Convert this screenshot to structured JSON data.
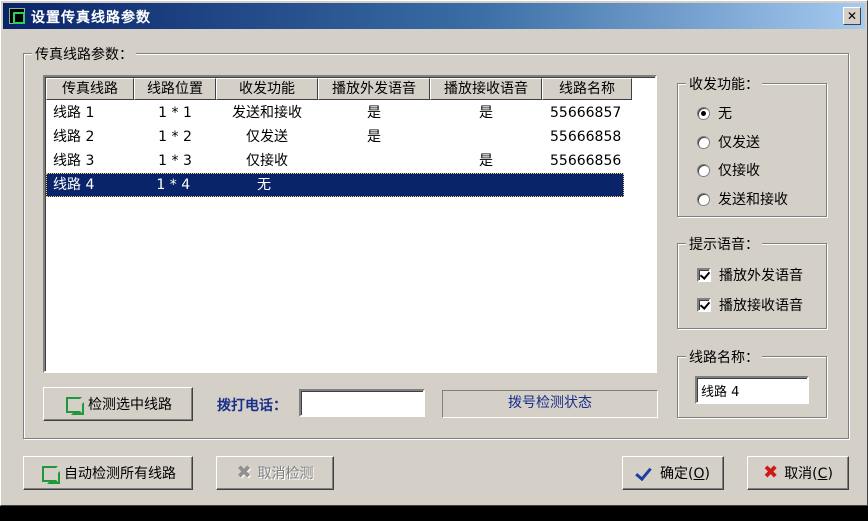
{
  "window": {
    "title": "设置传真线路参数",
    "close_glyph": "✕"
  },
  "fax_params_group": {
    "label": "传真线路参数："
  },
  "table": {
    "columns": [
      "传真线路",
      "线路位置",
      "收发功能",
      "播放外发语音",
      "播放接收语音",
      "线路名称"
    ],
    "rows": [
      [
        "线路 1",
        "1 * 1",
        "发送和接收",
        "是",
        "是",
        "55666857"
      ],
      [
        "线路 2",
        "1 * 2",
        "仅发送",
        "是",
        "",
        "55666858"
      ],
      [
        "线路 3",
        "1 * 3",
        "仅接收",
        "",
        "是",
        "55666856"
      ],
      [
        "线路 4",
        "1 * 4",
        "无",
        "",
        "",
        ""
      ]
    ],
    "selected_row": 3
  },
  "detect_selected_button": {
    "label": "检测选中线路",
    "icon": "network-icon"
  },
  "dial": {
    "label": "拨打电话：",
    "value": ""
  },
  "dial_status": {
    "text": "拨号检测状态"
  },
  "function_group": {
    "label": "收发功能：",
    "options": [
      "无",
      "仅发送",
      "仅接收",
      "发送和接收"
    ],
    "selected": 0
  },
  "voice_group": {
    "label": "提示语音：",
    "options": [
      {
        "label": "播放外发语音",
        "checked": true
      },
      {
        "label": "播放接收语音",
        "checked": true
      }
    ]
  },
  "line_name_group": {
    "label": "线路名称：",
    "value": "线路 4"
  },
  "footer": {
    "auto_detect_label": "自动检测所有线路",
    "cancel_detect_label": "取消检测",
    "ok_label": "确定(",
    "ok_key": "O",
    "ok_close": ")",
    "cancel_label": "取消(",
    "cancel_key": "C",
    "cancel_close": ")"
  },
  "colors": {
    "title_start": "#0a246a",
    "selection": "#0a246a",
    "accent_blue": "#1a2f8a",
    "cancel_red": "#d01818",
    "icon_green": "#1f9a3a"
  }
}
